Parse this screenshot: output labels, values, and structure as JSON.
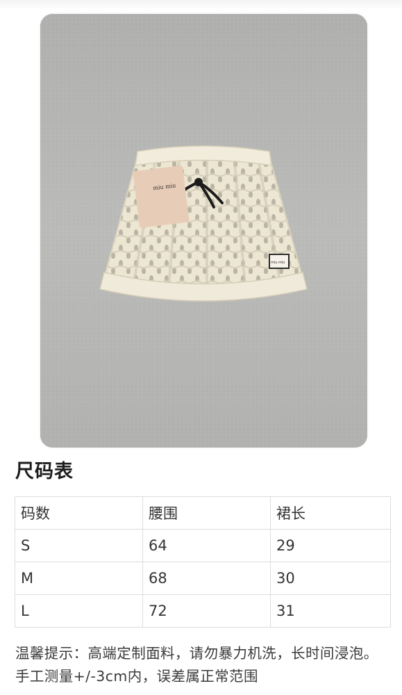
{
  "product_photo": {
    "tag_brand_text": "miu miu",
    "patch_brand_text": "miu miu"
  },
  "size_chart": {
    "title": "尺码表",
    "headers": [
      "码数",
      "腰围",
      "裙长"
    ],
    "rows": [
      [
        "S",
        "64",
        "29"
      ],
      [
        "M",
        "68",
        "30"
      ],
      [
        "L",
        "72",
        "31"
      ]
    ]
  },
  "note": "温馨提示：高端定制面料，请勿暴力机洗，长时间浸泡。手工测量+/-3cm内，误差属正常范围"
}
